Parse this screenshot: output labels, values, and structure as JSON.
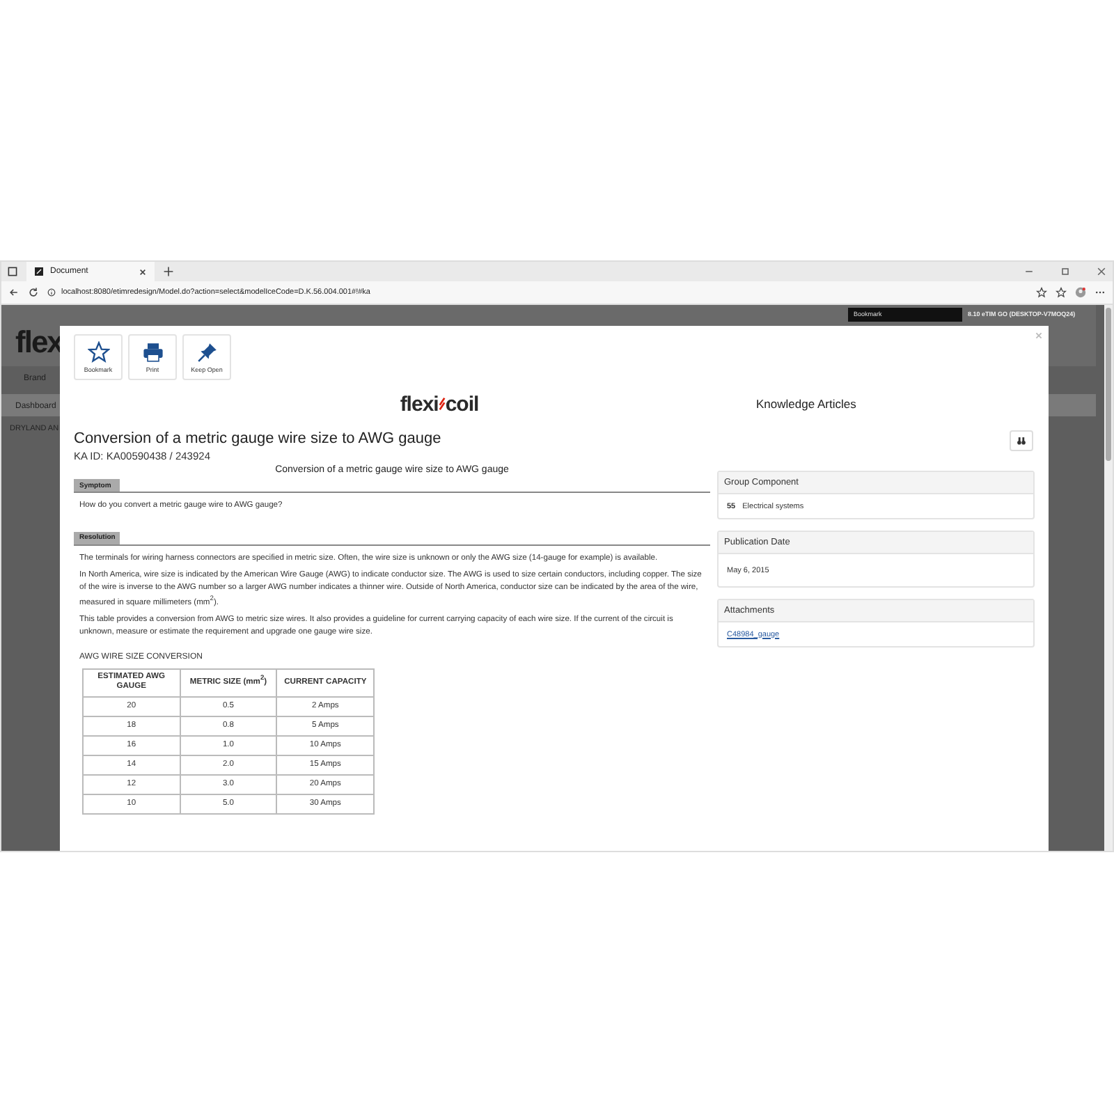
{
  "browser": {
    "tab_title": "Document",
    "url": "localhost:8080/etimredesign/Model.do?action=select&modelIceCode=D.K.56.004.001#!#ka"
  },
  "background_app": {
    "logo_fragment": "flex",
    "nav_link": "Brand",
    "menu_item": "Dashboard",
    "row_text": "DRYLAND AN",
    "bookmark_label": "Bookmark",
    "version": "8.10 eTIM GO (DESKTOP-V7MOQ24)"
  },
  "modal": {
    "toolbar": [
      {
        "label": "Bookmark",
        "kind": "star"
      },
      {
        "label": "Print",
        "kind": "printer"
      },
      {
        "label": "Keep Open",
        "kind": "pin"
      }
    ],
    "logo": {
      "left": "flexi",
      "right": "coil"
    },
    "heading": "Knowledge Articles",
    "title": "Conversion of a metric gauge wire size to AWG gauge",
    "ka_id": "KA ID: KA00590438 / 243924",
    "subtitle": "Conversion of a metric gauge wire size to AWG gauge",
    "sections": [
      {
        "label": "Symptom",
        "paragraphs": [
          "How do you convert a metric gauge wire to AWG gauge?"
        ]
      },
      {
        "label": "Resolution",
        "paragraphs": [
          "The terminals for wiring harness connectors are specified in metric size. Often, the wire size is unknown or only the AWG size (14-gauge for example) is available.",
          "In North America, wire size is indicated by the American Wire Gauge (AWG) to indicate conductor size. The AWG is used to size certain conductors, including copper. The size of the wire is inverse to the AWG number so a larger AWG number indicates a thinner wire. Outside of North America, conductor size can be indicated by the area of the wire, measured in square millimeters (mm$^{2}$).",
          "This table provides a conversion from AWG to metric size wires. It also provides a guideline for current carrying capacity of each wire size. If the current of the circuit is unknown, measure or estimate the requirement and upgrade one gauge wire size."
        ]
      }
    ],
    "table_caption": "AWG WIRE SIZE CONVERSION",
    "table": {
      "columns": [
        "ESTIMATED AWG GAUGE",
        "METRIC SIZE (mm$^{2}$)",
        "CURRENT CAPACITY"
      ],
      "rows": [
        [
          "20",
          "0.5",
          "2 Amps"
        ],
        [
          "18",
          "0.8",
          "5 Amps"
        ],
        [
          "16",
          "1.0",
          "10 Amps"
        ],
        [
          "14",
          "2.0",
          "15 Amps"
        ],
        [
          "12",
          "3.0",
          "20 Amps"
        ],
        [
          "10",
          "5.0",
          "30 Amps"
        ]
      ]
    },
    "side_panels": [
      {
        "title": "Group Component",
        "kind": "code",
        "code": "55",
        "value": "Electrical systems"
      },
      {
        "title": "Publication Date",
        "kind": "text",
        "value": "May 6, 2015"
      },
      {
        "title": "Attachments",
        "kind": "link",
        "value": "C48984_gauge"
      }
    ]
  }
}
